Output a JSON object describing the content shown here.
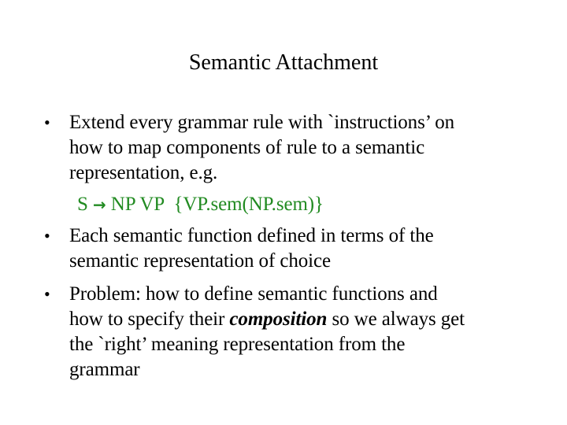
{
  "slide": {
    "title": "Semantic Attachment",
    "bullet_glyph": "•",
    "bullets": [
      {
        "lines": [
          "Extend every grammar rule with `instructions’ on",
          "how to map components of rule to a semantic",
          "representation, e.g."
        ],
        "example": {
          "lhs": "S",
          "arrow": "→",
          "rhs": "NP VP  {VP.sem(NP.sem)}",
          "color": "#228b22"
        }
      },
      {
        "lines": [
          "Each semantic function defined in terms of the",
          "semantic representation of choice"
        ]
      },
      {
        "lines": [
          "Problem: how to define semantic functions and",
          "how to specify their",
          "the `right’ meaning representation from the",
          "grammar"
        ],
        "emphasis": "composition",
        "after_emphasis": "so we always get"
      }
    ]
  }
}
